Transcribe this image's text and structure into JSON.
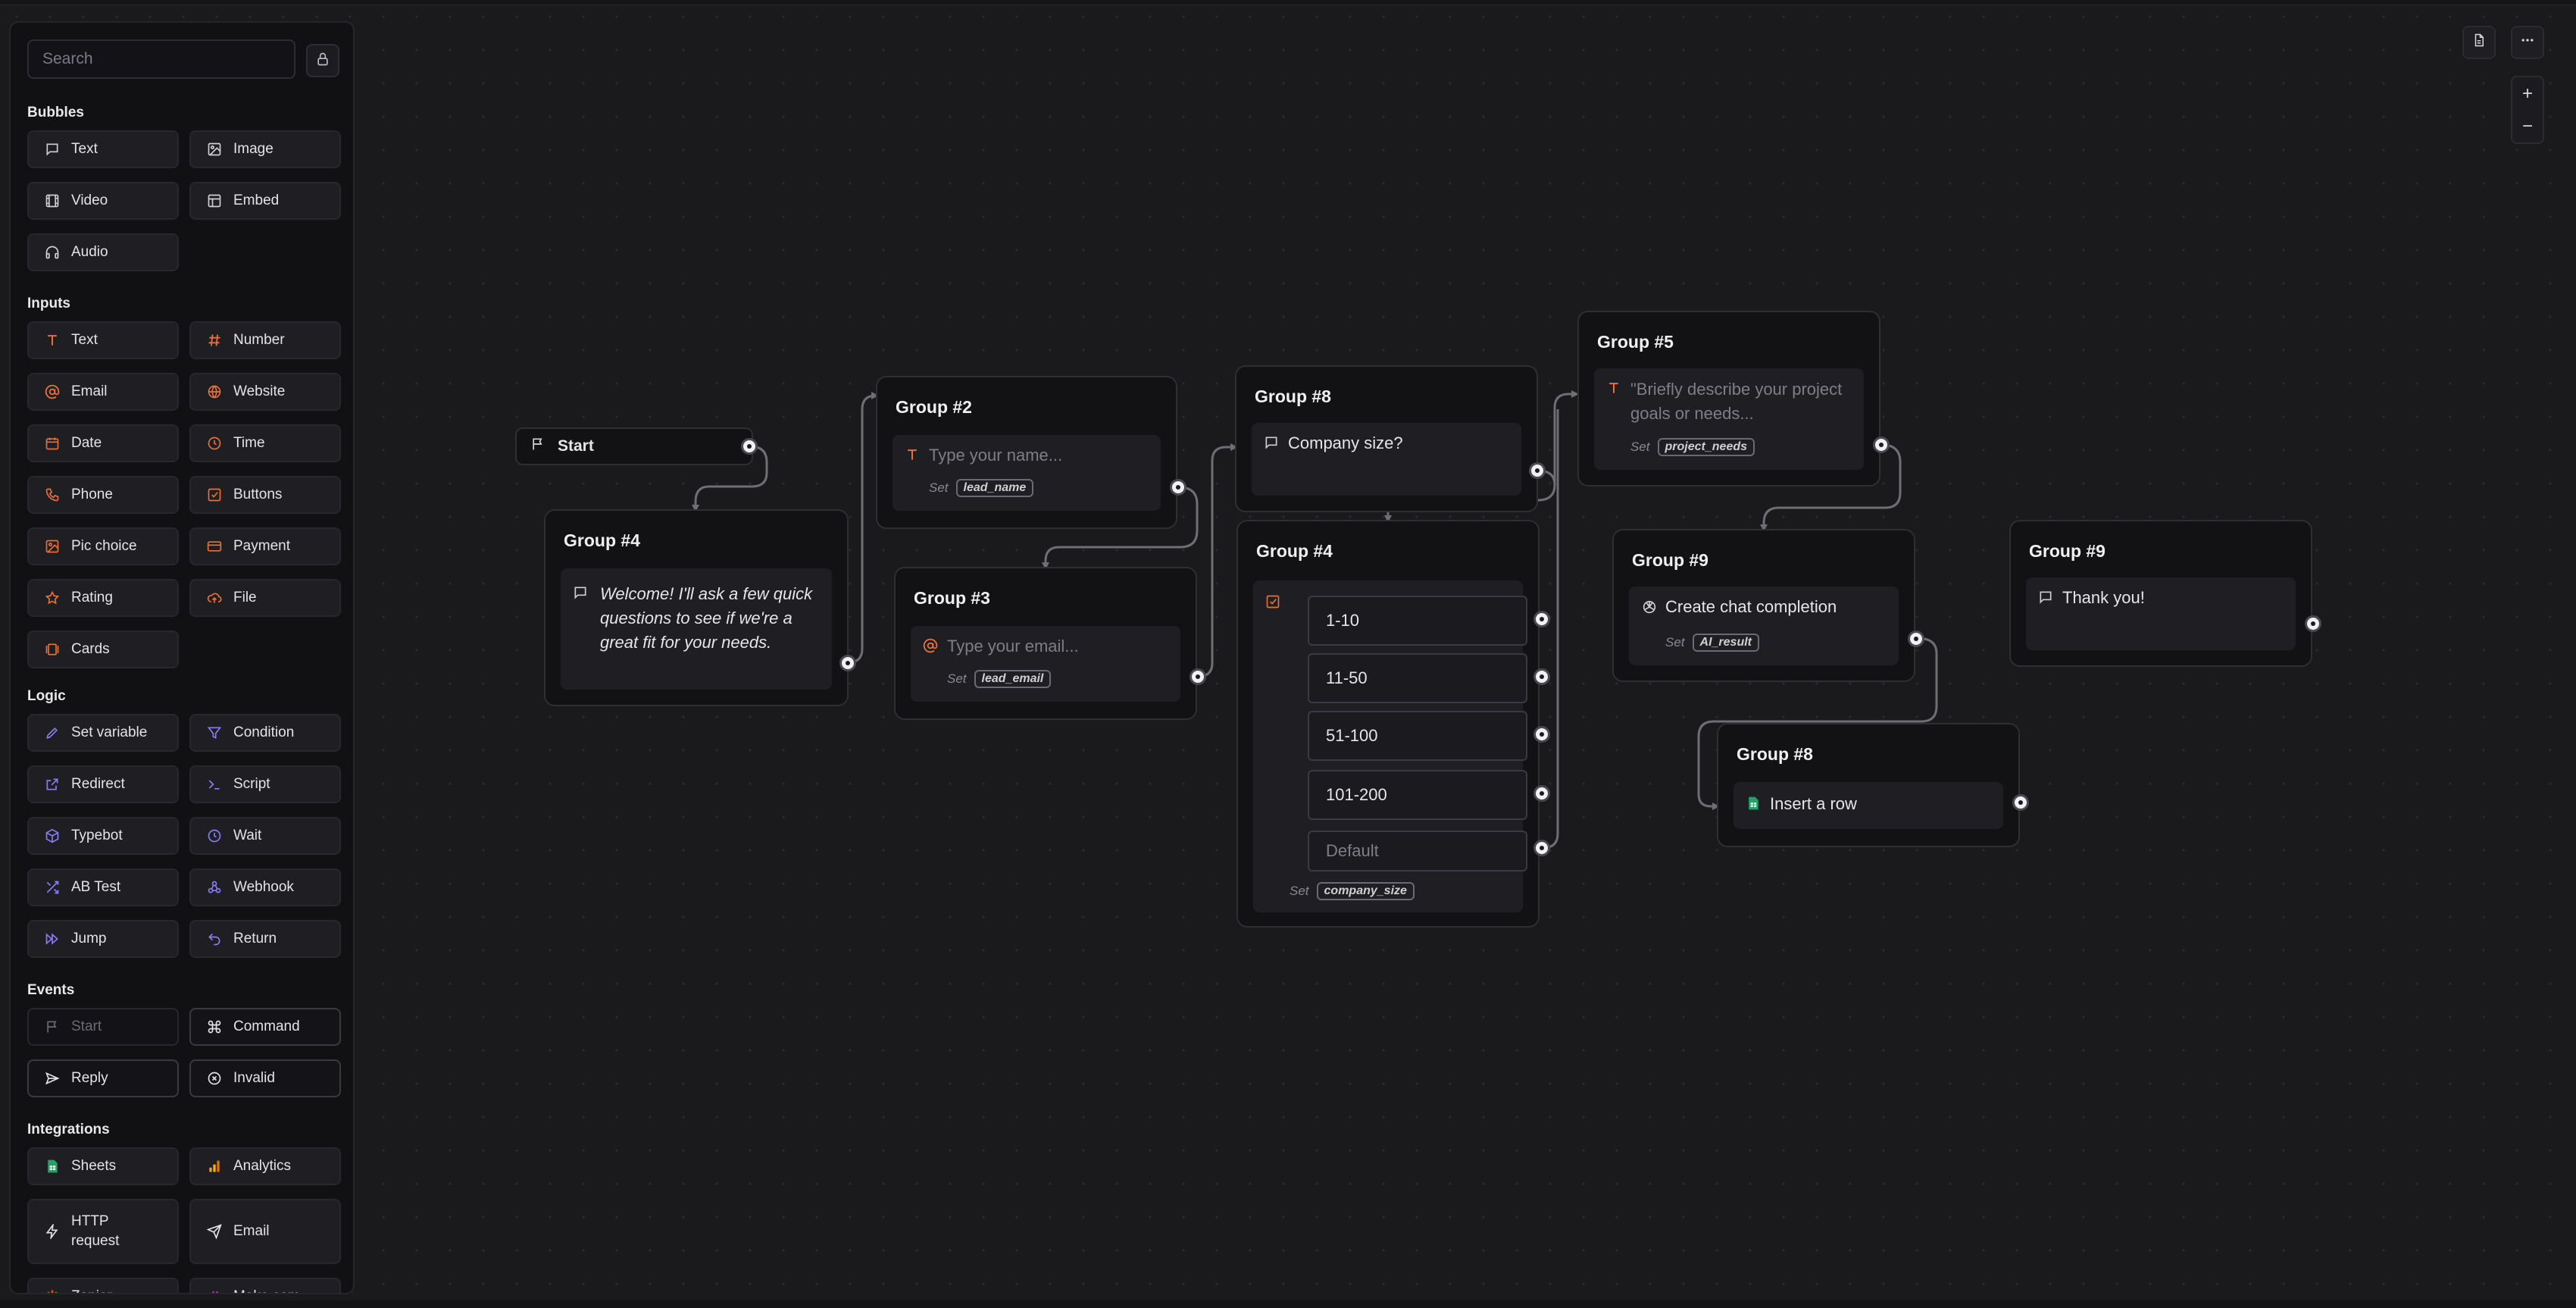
{
  "sidebar": {
    "search_placeholder": "Search",
    "sections": {
      "bubbles": "Bubbles",
      "inputs": "Inputs",
      "logic": "Logic",
      "events": "Events",
      "integrations": "Integrations"
    },
    "bubbles": [
      {
        "label": "Text",
        "icon": "message-icon"
      },
      {
        "label": "Image",
        "icon": "image-icon"
      },
      {
        "label": "Video",
        "icon": "film-icon"
      },
      {
        "label": "Embed",
        "icon": "embed-icon"
      },
      {
        "label": "Audio",
        "icon": "headphones-icon"
      }
    ],
    "inputs": [
      {
        "label": "Text",
        "icon": "text-t-icon"
      },
      {
        "label": "Number",
        "icon": "hash-icon"
      },
      {
        "label": "Email",
        "icon": "at-icon"
      },
      {
        "label": "Website",
        "icon": "globe-icon"
      },
      {
        "label": "Date",
        "icon": "calendar-icon"
      },
      {
        "label": "Time",
        "icon": "clock-icon"
      },
      {
        "label": "Phone",
        "icon": "phone-icon"
      },
      {
        "label": "Buttons",
        "icon": "checkbox-icon"
      },
      {
        "label": "Pic choice",
        "icon": "picture-icon"
      },
      {
        "label": "Payment",
        "icon": "credit-card-icon"
      },
      {
        "label": "Rating",
        "icon": "star-icon"
      },
      {
        "label": "File",
        "icon": "upload-cloud-icon"
      },
      {
        "label": "Cards",
        "icon": "cards-icon"
      }
    ],
    "logic": [
      {
        "label": "Set variable",
        "icon": "pen-icon"
      },
      {
        "label": "Condition",
        "icon": "filter-icon"
      },
      {
        "label": "Redirect",
        "icon": "external-link-icon"
      },
      {
        "label": "Script",
        "icon": "terminal-icon"
      },
      {
        "label": "Typebot",
        "icon": "cube-icon"
      },
      {
        "label": "Wait",
        "icon": "clock-icon"
      },
      {
        "label": "AB Test",
        "icon": "shuffle-icon"
      },
      {
        "label": "Webhook",
        "icon": "webhook-icon"
      },
      {
        "label": "Jump",
        "icon": "fast-forward-icon"
      },
      {
        "label": "Return",
        "icon": "undo-icon"
      }
    ],
    "events": [
      {
        "label": "Start",
        "icon": "flag-icon"
      },
      {
        "label": "Command",
        "icon": "command-icon"
      },
      {
        "label": "Reply",
        "icon": "send-icon"
      },
      {
        "label": "Invalid",
        "icon": "x-circle-icon"
      }
    ],
    "integrations": [
      {
        "label": "Sheets",
        "icon": "sheets-icon"
      },
      {
        "label": "Analytics",
        "icon": "analytics-icon"
      },
      {
        "label": "HTTP request",
        "icon": "bolt-icon"
      },
      {
        "label": "Email",
        "icon": "send-icon"
      },
      {
        "label": "Zapier",
        "icon": "zapier-icon"
      },
      {
        "label": "Make.com",
        "icon": "make-icon"
      }
    ]
  },
  "canvas": {
    "start": {
      "label": "Start"
    },
    "group4a": {
      "title": "Group #4",
      "message": "Welcome! I'll ask a few quick questions to see if we're a great fit for your needs."
    },
    "group2": {
      "title": "Group #2",
      "placeholder": "Type your name...",
      "set": "Set",
      "variable": "lead_name"
    },
    "group3": {
      "title": "Group #3",
      "placeholder": "Type your email...",
      "set": "Set",
      "variable": "lead_email"
    },
    "group8a": {
      "title": "Group #8",
      "message": "Company size?"
    },
    "group4b": {
      "title": "Group #4",
      "choices": [
        "1-10",
        "11-50",
        "51-100",
        "101-200"
      ],
      "default": "Default",
      "set": "Set",
      "variable": "company_size"
    },
    "group5": {
      "title": "Group #5",
      "placeholder": "\"Briefly describe your project goals or needs...",
      "set": "Set",
      "variable": "project_needs"
    },
    "group9a": {
      "title": "Group #9",
      "label": "Create chat completion",
      "set": "Set",
      "variable": "AI_result"
    },
    "group8b": {
      "title": "Group #8",
      "label": "Insert a row"
    },
    "group9b": {
      "title": "Group #9",
      "message": "Thank you!"
    }
  },
  "colors": {
    "orange": "#e8703a",
    "purple": "#8b7cf6",
    "green": "#21a366"
  }
}
